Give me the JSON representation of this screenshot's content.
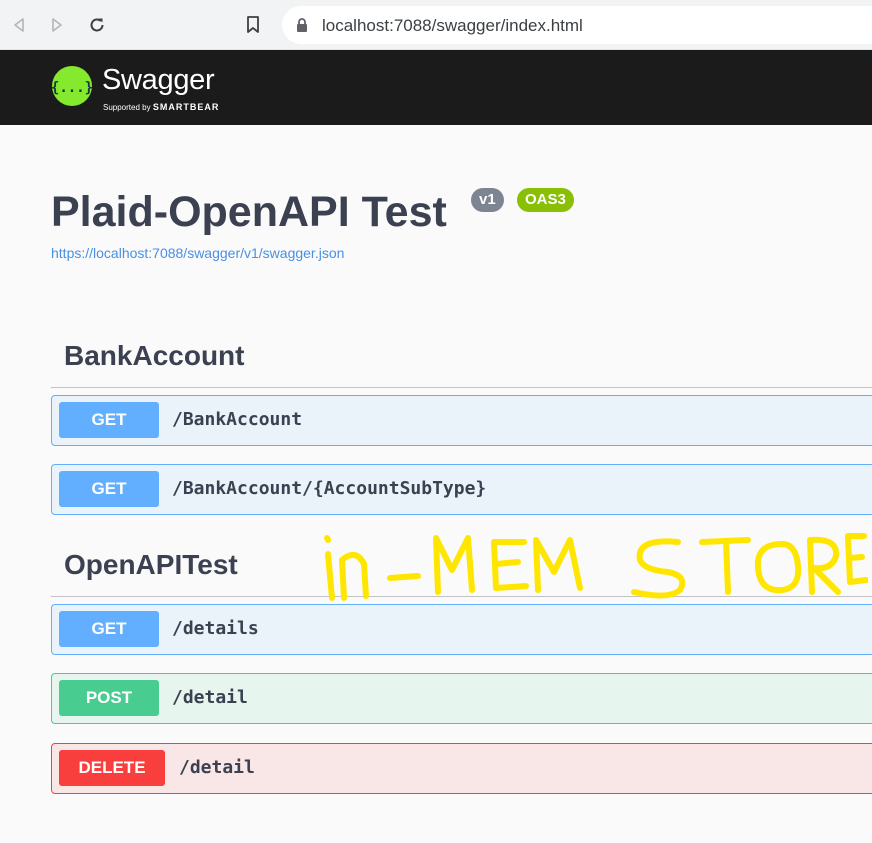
{
  "browser": {
    "url": "localhost:7088/swagger/index.html",
    "icons": [
      "back-icon",
      "forward-icon",
      "reload-icon",
      "bookmark-icon",
      "lock-icon"
    ]
  },
  "header": {
    "brand": "Swagger",
    "tagline_prefix": "Supported by",
    "tagline_brand": "SMARTBEAR",
    "logo_icon": "swagger-logo-icon",
    "logo_glyph": "{...}"
  },
  "info": {
    "title": "Plaid-OpenAPI Test",
    "version_badge": "v1",
    "oas_badge": "OAS3",
    "spec_url": "https://localhost:7088/swagger/v1/swagger.json"
  },
  "tags": [
    {
      "name": "BankAccount",
      "operations": [
        {
          "method": "GET",
          "path": "/BankAccount"
        },
        {
          "method": "GET",
          "path": "/BankAccount/{AccountSubType}"
        }
      ]
    },
    {
      "name": "OpenAPITest",
      "operations": [
        {
          "method": "GET",
          "path": "/details"
        },
        {
          "method": "POST",
          "path": "/detail"
        },
        {
          "method": "DELETE",
          "path": "/detail"
        }
      ]
    }
  ],
  "annotation": {
    "text": "in-MEM STORE",
    "color": "#ffe600"
  },
  "colors": {
    "get": "#61affe",
    "post": "#49cc90",
    "delete": "#f93e3e",
    "header_bg": "#1b1b1b",
    "logo_green": "#85ea2d",
    "text": "#3b4151"
  }
}
